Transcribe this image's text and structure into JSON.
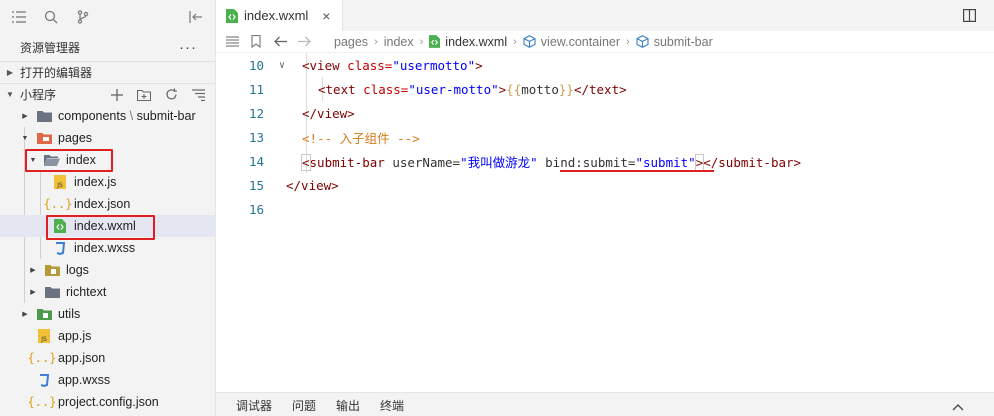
{
  "sidebar": {
    "title": "资源管理器",
    "more": "···",
    "sections": {
      "open_editors": "打开的编辑器",
      "project": "小程序"
    },
    "tree": [
      {
        "label": "components",
        "suffix": "\\",
        "suffix2": "submit-bar",
        "icon": "folder-icon"
      },
      {
        "label": "pages",
        "icon": "folder-pages-icon"
      },
      {
        "label": "index",
        "icon": "folder-open-icon"
      },
      {
        "label": "index.js",
        "icon": "js-file-icon"
      },
      {
        "label": "index.json",
        "icon": "json-file-icon"
      },
      {
        "label": "index.wxml",
        "icon": "wxml-file-icon"
      },
      {
        "label": "index.wxss",
        "icon": "wxss-file-icon"
      },
      {
        "label": "logs",
        "icon": "folder-logs-icon"
      },
      {
        "label": "richtext",
        "icon": "folder-icon"
      },
      {
        "label": "utils",
        "icon": "folder-utils-icon"
      },
      {
        "label": "app.js",
        "icon": "js-file-icon"
      },
      {
        "label": "app.json",
        "icon": "json-file-icon"
      },
      {
        "label": "app.wxss",
        "icon": "wxss-file-icon"
      },
      {
        "label": "project.config.json",
        "icon": "json-file-icon"
      }
    ]
  },
  "editor": {
    "tab": {
      "label": "index.wxml",
      "close": "×"
    },
    "breadcrumb": {
      "pages": "pages",
      "index": "index",
      "file": "index.wxml",
      "container": "view.container",
      "component": "submit-bar"
    },
    "lines": [
      {
        "n": "10"
      },
      {
        "n": "11"
      },
      {
        "n": "12"
      },
      {
        "n": "13"
      },
      {
        "n": "14"
      },
      {
        "n": "15"
      },
      {
        "n": "16"
      }
    ],
    "code": {
      "l10_tag": "<view",
      "l10_attr": " class=",
      "l10_val": "\"usermotto\"",
      "l10_end": ">",
      "l11_tag": "<text",
      "l11_attr": " class=",
      "l11_val": "\"user-motto\"",
      "l11_gt": ">",
      "l11_ob": "{{",
      "l11_expr": "motto",
      "l11_cb": "}}",
      "l11_close": "</text>",
      "l12": "</view>",
      "l13": "<!-- 入子组件 -->",
      "l14_lt": "<",
      "l14_tag": "submit-bar",
      "l14_attr1": " userName=",
      "l14_val1": "\"我叫做游龙\"",
      "l14_attr2": " bind:submit=",
      "l14_val2": "\"submit\"",
      "l14_gt": ">",
      "l14_close": "</submit-bar>",
      "l15": "</view>"
    },
    "bottom_tabs": [
      "调试器",
      "问题",
      "输出",
      "终端"
    ]
  },
  "colors": {
    "highlight": "#e02020",
    "tag": "#800000",
    "string": "#0000ff",
    "comment": "#d47a17"
  }
}
